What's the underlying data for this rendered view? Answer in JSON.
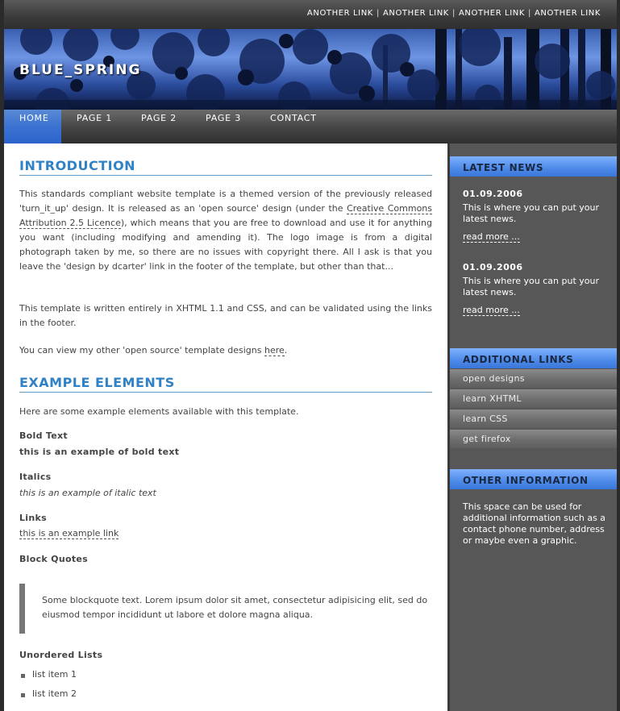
{
  "header": {
    "top_links": [
      "ANOTHER LINK",
      "ANOTHER LINK",
      "ANOTHER LINK",
      "ANOTHER LINK"
    ],
    "separator": "|",
    "logo": "BLUE_SPRING"
  },
  "menu": {
    "items": [
      "HOME",
      "PAGE 1",
      "PAGE 2",
      "PAGE 3",
      "CONTACT"
    ],
    "active": "HOME"
  },
  "main": {
    "intro_heading": "INTRODUCTION",
    "intro_p1_before": "This standards compliant website template is a themed version of the previously released 'turn_it_up' design. It is released as an 'open source' design (under the ",
    "intro_p1_link": "Creative Commons Attribution 2.5 Licence",
    "intro_p1_after": "), which means that you are free to download and use it for anything you want (including modifying and amending it). The logo image is from a digital photograph taken by me, so there are no issues with copyright there. All I ask is that you leave the 'design by dcarter' link in the footer of the template, but other than that...",
    "intro_p2": "This template is written entirely in XHTML 1.1 and CSS, and can be validated using the links in the footer.",
    "intro_p3_before": "You can view my other 'open source' template designs ",
    "intro_p3_link": "here",
    "intro_p3_after": ".",
    "examples_heading": "EXAMPLE ELEMENTS",
    "examples_intro": "Here are some example elements available with this template.",
    "bold_title": "Bold Text",
    "bold_example": "this is an example of bold text",
    "italic_title": "Italics",
    "italic_example": "this is an example of italic text",
    "links_title": "Links",
    "link_example": "this is an example link",
    "quotes_title": "Block Quotes",
    "quote_text": "Some blockquote text. Lorem ipsum dolor sit amet, consectetur adipisicing elit, sed do eiusmod tempor incididunt ut labore et dolore magna aliqua.",
    "lists_title": "Unordered Lists",
    "list_items": [
      "list item 1",
      "list item 2"
    ]
  },
  "sidebar": {
    "news_heading": "LATEST NEWS",
    "news": [
      {
        "date": "01.09.2006",
        "text": "This is where you can put your latest news.",
        "more": "read more ..."
      },
      {
        "date": "01.09.2006",
        "text": "This is where you can put your latest news.",
        "more": "read more ..."
      }
    ],
    "links_heading": "ADDITIONAL LINKS",
    "links": [
      "open designs",
      "learn XHTML",
      "learn CSS",
      "get firefox"
    ],
    "other_heading": "OTHER INFORMATION",
    "other_text": "This space can be used for additional information such as a contact phone number, address or maybe even a graphic."
  },
  "colors": {
    "accent": "#2f82c6",
    "menu_active": "#3b72d0",
    "sidebar_bg": "#575757"
  }
}
